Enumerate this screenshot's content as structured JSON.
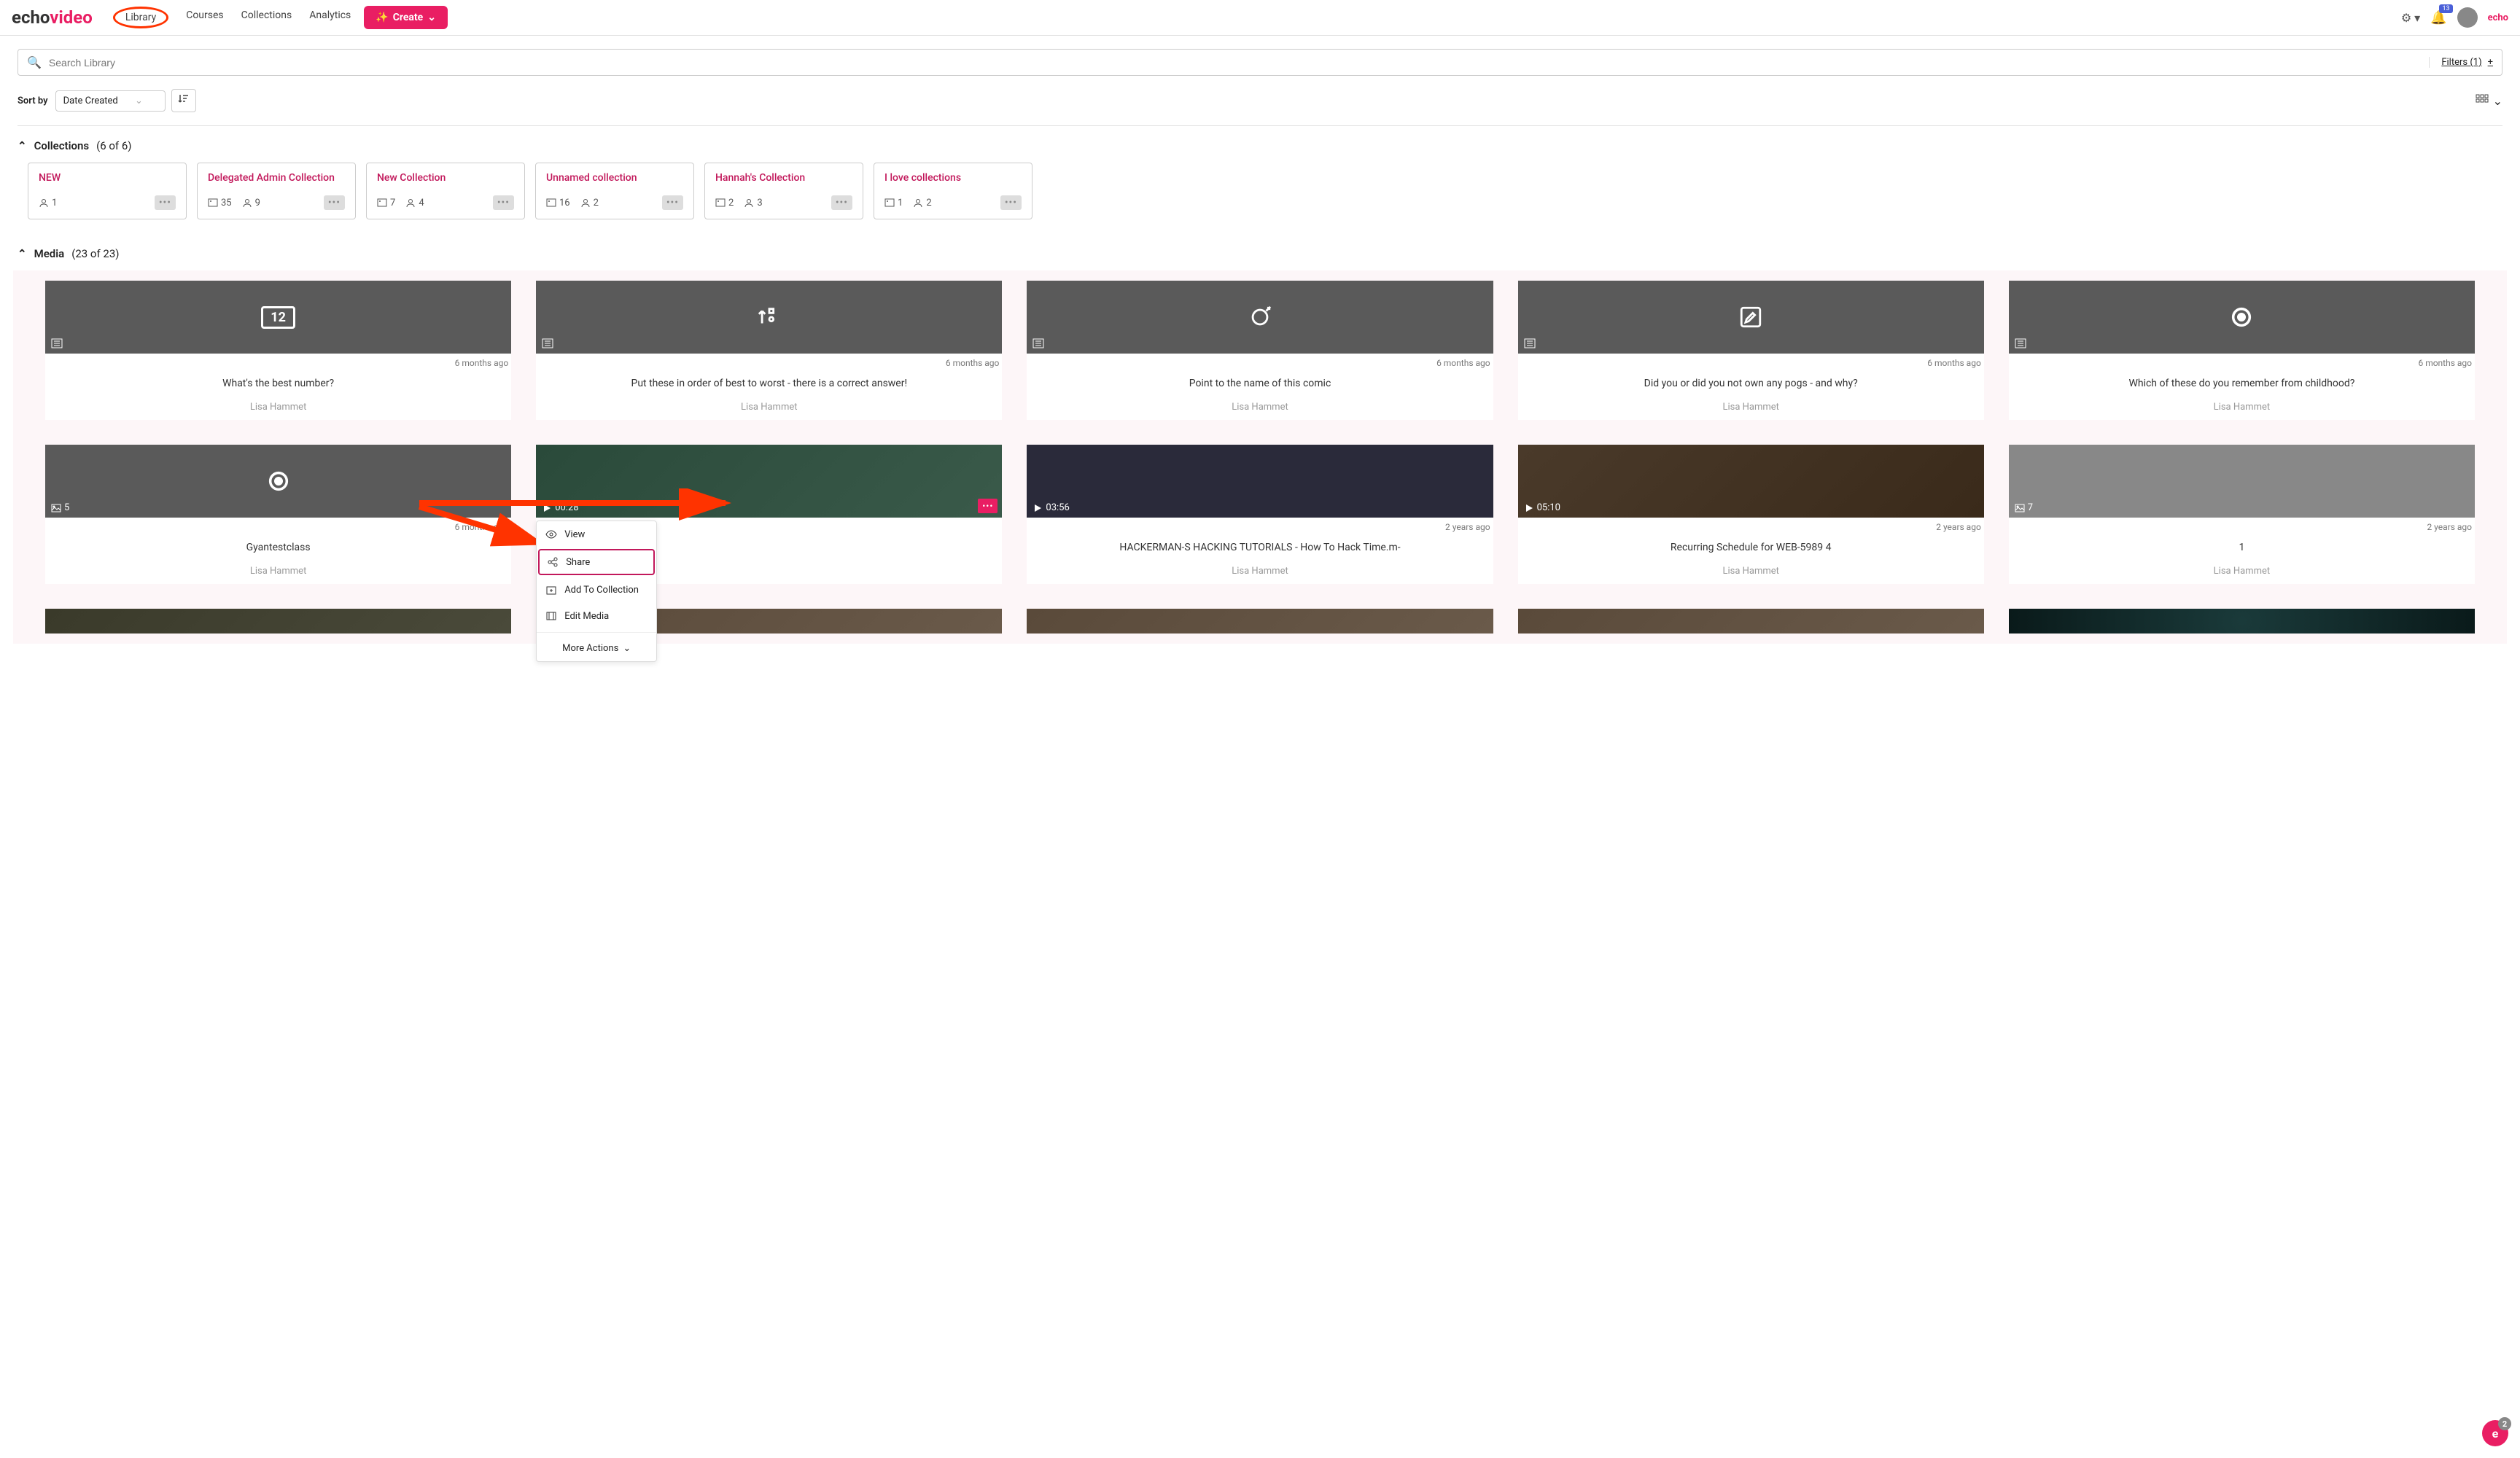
{
  "header": {
    "logo_part1": "echo",
    "logo_part2": "video",
    "nav": [
      "Library",
      "Courses",
      "Collections",
      "Analytics"
    ],
    "create_label": "Create",
    "bell_count": "13",
    "echo_small": "echo"
  },
  "search": {
    "placeholder": "Search Library",
    "filters_label": "Filters (1)"
  },
  "toolbar": {
    "sort_label": "Sort by",
    "sort_value": "Date Created"
  },
  "collections_section": {
    "title": "Collections",
    "count": "(6 of 6)",
    "items": [
      {
        "title": "NEW",
        "users": "1"
      },
      {
        "title": "Delegated Admin Collection",
        "media": "35",
        "users": "9"
      },
      {
        "title": "New Collection",
        "media": "7",
        "users": "4"
      },
      {
        "title": "Unnamed collection",
        "media": "16",
        "users": "2"
      },
      {
        "title": "Hannah's Collection",
        "media": "2",
        "users": "3"
      },
      {
        "title": "I love collections",
        "media": "1",
        "users": "2"
      }
    ]
  },
  "media_section": {
    "title": "Media",
    "count": "(23 of 23)",
    "row1": [
      {
        "date": "6 months ago",
        "title": "What's the best number?",
        "author": "Lisa Hammet",
        "icon": "number",
        "icon_text": "12"
      },
      {
        "date": "6 months ago",
        "title": "Put these in order of best to worst - there is a correct answer!",
        "author": "Lisa Hammet",
        "icon": "order"
      },
      {
        "date": "6 months ago",
        "title": "Point to the name of this comic",
        "author": "Lisa Hammet",
        "icon": "target"
      },
      {
        "date": "6 months ago",
        "title": "Did you or did you not own any pogs - and why?",
        "author": "Lisa Hammet",
        "icon": "edit"
      },
      {
        "date": "6 months ago",
        "title": "Which of these do you remember from childhood?",
        "author": "Lisa Hammet",
        "icon": "radio"
      }
    ],
    "row2": [
      {
        "date": "6 months ago",
        "title": "Gyantestclass",
        "author": "Lisa Hammet",
        "icon": "radio",
        "badge": "5",
        "badge_icon": "image"
      },
      {
        "date": "",
        "title": "",
        "author": "",
        "icon": "img",
        "badge": "00:28",
        "badge_icon": "play",
        "has_menu": true
      },
      {
        "date": "2 years ago",
        "title": "HACKERMAN-S HACKING TUTORIALS - How To Hack Time.m-",
        "author": "Lisa Hammet",
        "icon": "dark",
        "badge": "03:56",
        "badge_icon": "play"
      },
      {
        "date": "2 years ago",
        "title": "Recurring Schedule for WEB-5989 4",
        "author": "Lisa Hammet",
        "icon": "anime",
        "badge": "05:10",
        "badge_icon": "play"
      },
      {
        "date": "2 years ago",
        "title": "1",
        "author": "Lisa Hammet",
        "icon": "plain",
        "badge": "7",
        "badge_icon": "image"
      }
    ]
  },
  "context_menu": {
    "view": "View",
    "share": "Share",
    "add": "Add To Collection",
    "edit": "Edit Media",
    "more": "More Actions"
  },
  "floating": {
    "letter": "e",
    "count": "2"
  }
}
